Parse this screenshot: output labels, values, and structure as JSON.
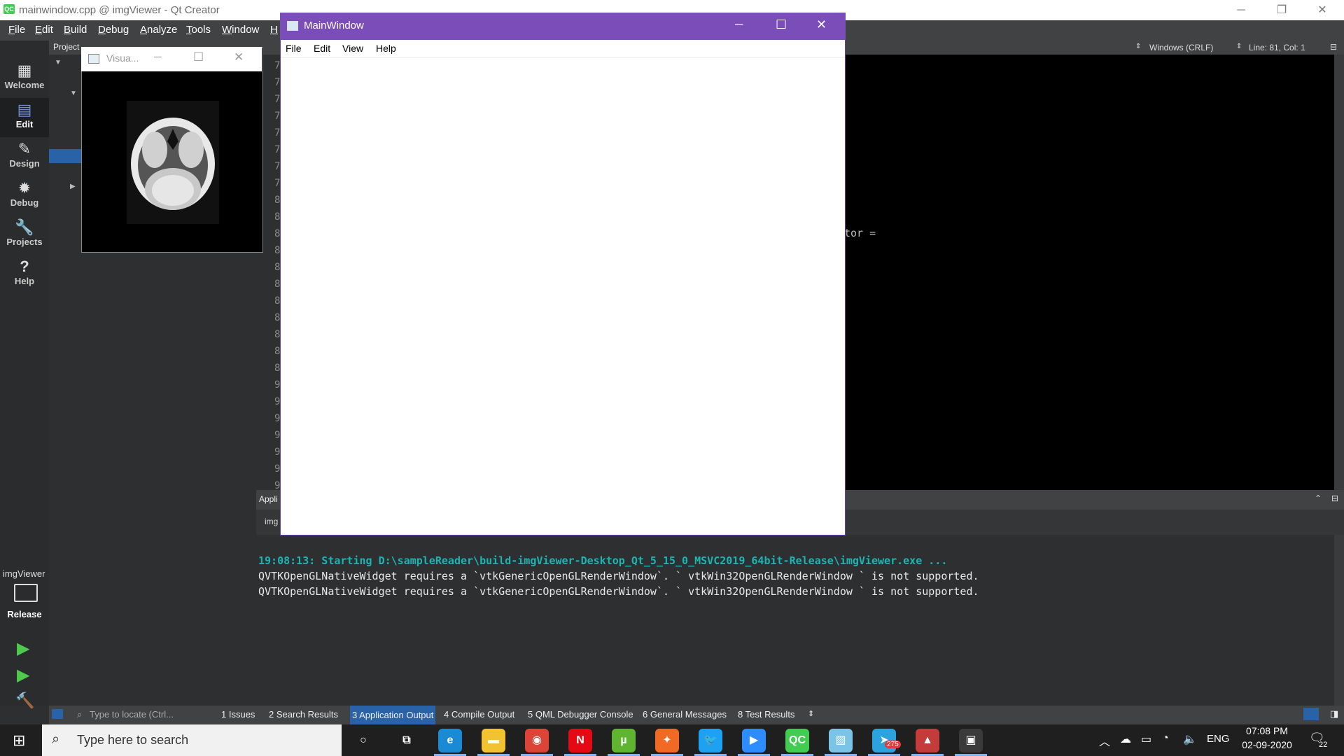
{
  "qtcreator": {
    "window_title": "mainwindow.cpp @ imgViewer - Qt Creator",
    "app_icon": "QC",
    "controls": {
      "minimize": "─",
      "restore": "❐",
      "close": "✕"
    },
    "menu": [
      "File",
      "Edit",
      "Build",
      "Debug",
      "Analyze",
      "Tools",
      "Window",
      "H"
    ],
    "modes": [
      {
        "label": "Welcome",
        "icon": "grid-icon",
        "glyph": "▦"
      },
      {
        "label": "Edit",
        "icon": "edit-icon",
        "glyph": "▤"
      },
      {
        "label": "Design",
        "icon": "pencil-icon",
        "glyph": "✎"
      },
      {
        "label": "Debug",
        "icon": "bug-icon",
        "glyph": "✹"
      },
      {
        "label": "Projects",
        "icon": "wrench-icon",
        "glyph": "🔧"
      },
      {
        "label": "Help",
        "icon": "help-icon",
        "glyph": "?"
      }
    ],
    "project_header": "Project",
    "kit": {
      "project": "imgViewer",
      "config": "Release"
    },
    "run_buttons": {
      "run": "▶",
      "debug_run": "▶",
      "build": "🔨"
    },
    "editor_status": {
      "line_ending": "Windows (CRLF)",
      "position": "Line: 81, Col: 1"
    },
    "gutter_digits": [
      "7",
      "7",
      "7",
      "7",
      "7",
      "7",
      "7",
      "7",
      "8",
      "8",
      "8",
      "8",
      "8",
      "8",
      "8",
      "8",
      "8",
      "8",
      "8",
      "9",
      "9",
      "9",
      "9",
      "9",
      "9",
      "9"
    ],
    "code_fragment": "tor =",
    "output_header": "Appli",
    "output_tab": "img",
    "output_lines": [
      "19:08:13: Starting D:\\sampleReader\\build-imgViewer-Desktop_Qt_5_15_0_MSVC2019_64bit-Release\\imgViewer.exe ...",
      "QVTKOpenGLNativeWidget requires a `vtkGenericOpenGLRenderWindow`. ` vtkWin32OpenGLRenderWindow ` is not supported.",
      "QVTKOpenGLNativeWidget requires a `vtkGenericOpenGLRenderWindow`. ` vtkWin32OpenGLRenderWindow ` is not supported."
    ],
    "locate_placeholder": "Type to locate (Ctrl...",
    "bottom_tabs": [
      {
        "num": "1",
        "label": "Issues"
      },
      {
        "num": "2",
        "label": "Search Results"
      },
      {
        "num": "3",
        "label": "Application Output",
        "active": true
      },
      {
        "num": "4",
        "label": "Compile Output"
      },
      {
        "num": "5",
        "label": "QML Debugger Console"
      },
      {
        "num": "6",
        "label": "General Messages"
      },
      {
        "num": "8",
        "label": "Test Results"
      }
    ]
  },
  "vtk_window": {
    "title": "Visua...",
    "controls": {
      "minimize": "─",
      "maximize": "☐",
      "close": "✕"
    }
  },
  "main_window": {
    "title": "MainWindow",
    "controls": {
      "minimize": "─",
      "maximize": "☐",
      "close": "✕"
    },
    "menu": [
      "File",
      "Edit",
      "View",
      "Help"
    ]
  },
  "taskbar": {
    "search_placeholder": "Type here to search",
    "apps": [
      {
        "name": "cortana",
        "glyph": "○"
      },
      {
        "name": "task-view",
        "glyph": "⧉"
      },
      {
        "name": "edge",
        "glyph": "e",
        "color": "#1a8ad4"
      },
      {
        "name": "file-explorer",
        "glyph": "▬",
        "color": "#f2c230"
      },
      {
        "name": "chrome",
        "glyph": "◉",
        "color": "#db4437"
      },
      {
        "name": "netflix",
        "glyph": "N",
        "color": "#e50914"
      },
      {
        "name": "utorrent",
        "glyph": "µ",
        "color": "#5fb530"
      },
      {
        "name": "compass",
        "glyph": "✦",
        "color": "#f06a25"
      },
      {
        "name": "twitter",
        "glyph": "🐦",
        "color": "#1da1f2"
      },
      {
        "name": "zoom",
        "glyph": "▶",
        "color": "#2d8cff"
      },
      {
        "name": "qt-creator",
        "glyph": "QC",
        "color": "#41cd52"
      },
      {
        "name": "notepad",
        "glyph": "▨",
        "color": "#7ac4e8"
      },
      {
        "name": "telegram",
        "glyph": "➤",
        "color": "#2aa3df",
        "badge": "275"
      },
      {
        "name": "vtk-app",
        "glyph": "▲",
        "color": "#c43b3b"
      },
      {
        "name": "imgviewer-app",
        "glyph": "▣",
        "color": "#3a3a3a"
      }
    ],
    "tray": {
      "language": "ENG",
      "time": "07:08 PM",
      "date": "02-09-2020",
      "notifications": "22"
    }
  }
}
